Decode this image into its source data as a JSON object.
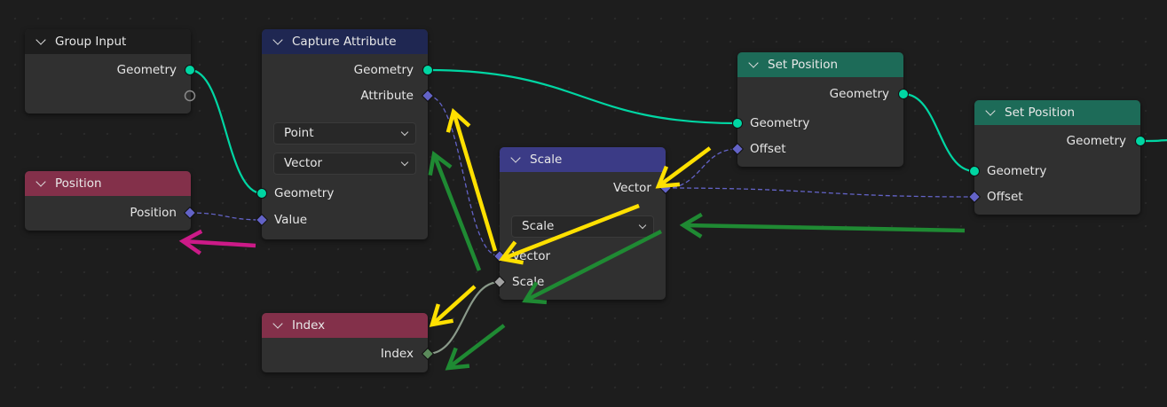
{
  "nodes": {
    "group_input": {
      "title": "Group Input",
      "header_color": "#1d1d1d",
      "outputs": [
        "Geometry"
      ]
    },
    "position": {
      "title": "Position",
      "header_color": "#83304a",
      "outputs": [
        "Position"
      ]
    },
    "capture_attribute": {
      "title": "Capture Attribute",
      "header_color": "#1f2752",
      "outputs": [
        "Geometry",
        "Attribute"
      ],
      "domain": "Point",
      "data_type": "Vector",
      "inputs": [
        "Geometry",
        "Value"
      ]
    },
    "scale": {
      "title": "Scale",
      "header_color": "#3b3b86",
      "outputs": [
        "Vector"
      ],
      "operation": "Scale",
      "inputs": [
        "Vector",
        "Scale"
      ]
    },
    "index": {
      "title": "Index",
      "header_color": "#83304a",
      "outputs": [
        "Index"
      ]
    },
    "set_position_1": {
      "title": "Set Position",
      "header_color": "#1d6b58",
      "outputs": [
        "Geometry"
      ],
      "inputs": [
        "Geometry",
        "Offset"
      ]
    },
    "set_position_2": {
      "title": "Set Position",
      "header_color": "#1d6b58",
      "outputs": [
        "Geometry"
      ],
      "inputs": [
        "Geometry",
        "Offset"
      ]
    }
  },
  "colors": {
    "geometry_socket": "#00d6a3",
    "vector_socket": "#6363c7",
    "float_socket": "#a1a1a1",
    "int_socket": "#5b8a5b",
    "annotation_yellow": "#ffe000",
    "annotation_green": "#1f8a33",
    "annotation_magenta": "#cc1a88"
  }
}
